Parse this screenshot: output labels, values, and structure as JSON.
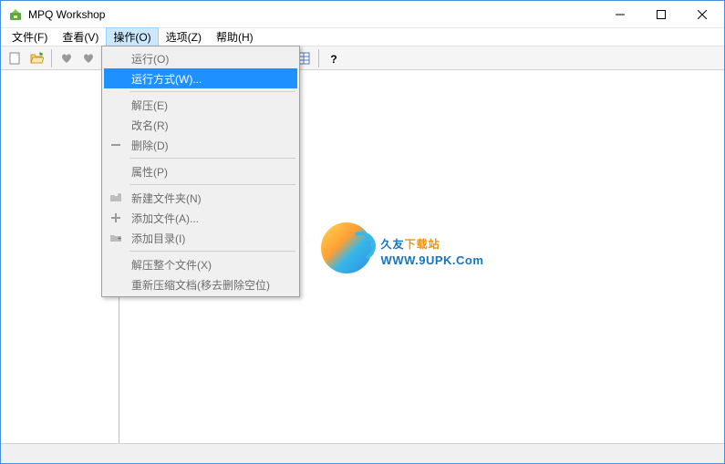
{
  "window": {
    "title": "MPQ Workshop"
  },
  "menubar": {
    "items": [
      {
        "label": "文件(F)"
      },
      {
        "label": "查看(V)"
      },
      {
        "label": "操作(O)"
      },
      {
        "label": "选项(Z)"
      },
      {
        "label": "帮助(H)"
      }
    ],
    "activeIndex": 2
  },
  "dropdown": {
    "groups": [
      [
        {
          "label": "运行(O)",
          "enabled": false,
          "highlighted": false,
          "icon": ""
        },
        {
          "label": "运行方式(W)...",
          "enabled": true,
          "highlighted": true,
          "icon": ""
        }
      ],
      [
        {
          "label": "解压(E)",
          "enabled": false,
          "highlighted": false,
          "icon": ""
        },
        {
          "label": "改名(R)",
          "enabled": false,
          "highlighted": false,
          "icon": ""
        },
        {
          "label": "删除(D)",
          "enabled": false,
          "highlighted": false,
          "icon": "minus"
        }
      ],
      [
        {
          "label": "属性(P)",
          "enabled": false,
          "highlighted": false,
          "icon": ""
        }
      ],
      [
        {
          "label": "新建文件夹(N)",
          "enabled": false,
          "highlighted": false,
          "icon": "folder-new"
        },
        {
          "label": "添加文件(A)...",
          "enabled": false,
          "highlighted": false,
          "icon": "plus"
        },
        {
          "label": "添加目录(I)",
          "enabled": false,
          "highlighted": false,
          "icon": "folder-add"
        }
      ],
      [
        {
          "label": "解压整个文件(X)",
          "enabled": false,
          "highlighted": false,
          "icon": ""
        },
        {
          "label": "重新压缩文档(移去删除空位)",
          "enabled": false,
          "highlighted": false,
          "icon": ""
        }
      ]
    ]
  },
  "watermark": {
    "cn_prefix": "久友",
    "cn_suffix": "下载站",
    "en": "WWW.9UPK.Com",
    "bg_text": "www . 9UPK . COM"
  }
}
